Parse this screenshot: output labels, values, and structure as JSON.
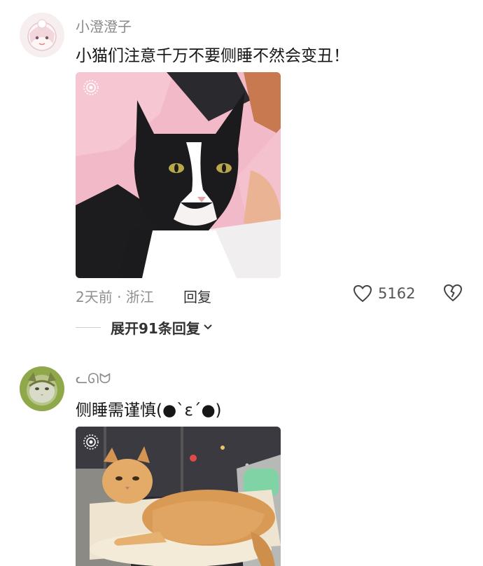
{
  "comments": [
    {
      "username": "小澄澄子",
      "text": "小猫们注意千万不要侧睡不然会变丑！",
      "meta": "2天前 · 浙江",
      "reply_label": "回复",
      "likes": "5162",
      "expand_label": "展开91条回复"
    },
    {
      "username": "ᓚᘏᗢ",
      "text": "侧睡需谨慎(●`ε´●)"
    }
  ],
  "icons": {
    "like": "heart-outline-icon",
    "dislike": "broken-heart-icon",
    "expand": "chevron-down-icon",
    "live": "live-photo-icon"
  }
}
